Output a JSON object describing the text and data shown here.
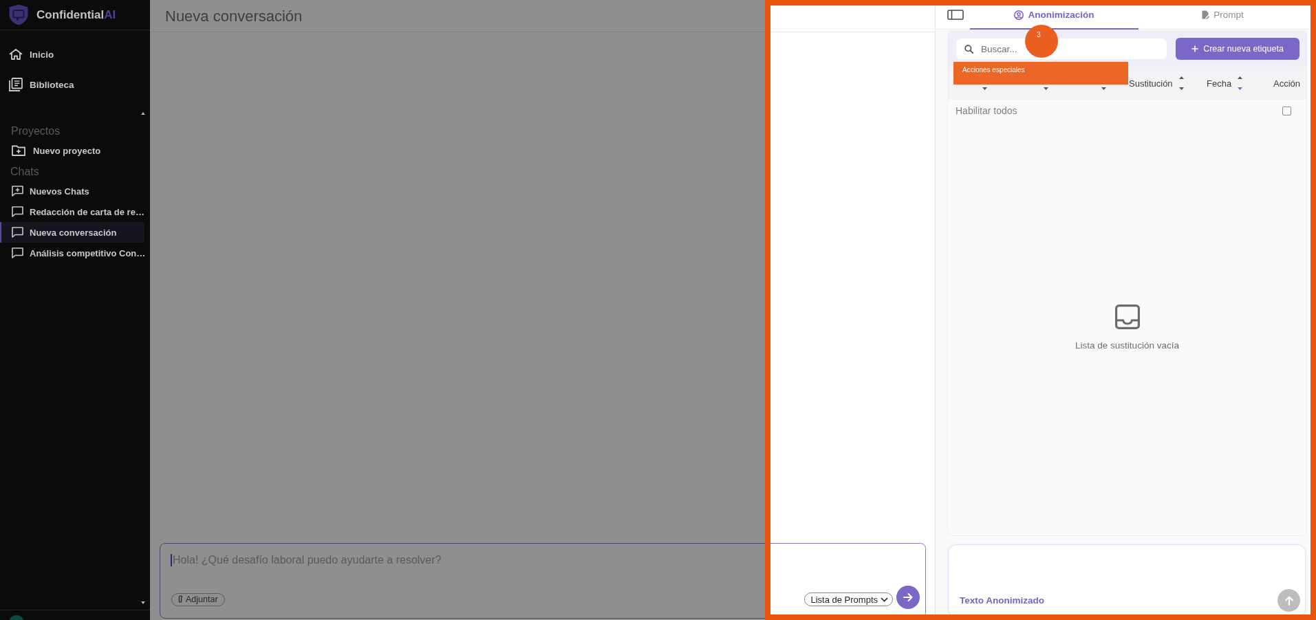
{
  "sidebar": {
    "brand": {
      "name": "Confidential",
      "accent": "AI"
    },
    "nav": [
      {
        "label": "Inicio"
      },
      {
        "label": "Biblioteca"
      }
    ],
    "sections": [
      {
        "title": "Proyectos",
        "items": [
          {
            "label": "Nuevo proyecto",
            "kind": "create",
            "selected": false
          }
        ]
      },
      {
        "title": "Chats",
        "items": [
          {
            "label": "Nuevos Chats",
            "kind": "create",
            "selected": false
          },
          {
            "label": "Redacción de carta de re…",
            "kind": "chat",
            "selected": false
          },
          {
            "label": "Nueva conversación",
            "kind": "chat",
            "selected": true
          },
          {
            "label": "Análisis competitivo Con…",
            "kind": "chat",
            "selected": false
          }
        ]
      }
    ]
  },
  "main": {
    "title": "Nueva conversación",
    "composer": {
      "placeholder": "Hola! ¿Qué desafío laboral puedo ayudarte a resolver?",
      "focused": true,
      "attach_button": "Adjuntar",
      "prompt_menu": "Lista de Prompts"
    }
  },
  "right_panel": {
    "tabs": [
      {
        "label": "Anonimización",
        "selected": true
      },
      {
        "label": "Prompt",
        "selected": false
      }
    ],
    "search": {
      "placeholder": "Buscar..."
    },
    "create_button": "Crear nueva etiqueta",
    "table": {
      "columns": [
        {
          "sorted": false
        },
        {
          "sorted": false
        },
        {
          "sorted": false
        },
        {
          "label": "Sustitución",
          "sorted": false
        },
        {
          "label": "Fecha",
          "sorted": true
        },
        {
          "label": "Acción"
        }
      ],
      "enable_all": {
        "label": "Habilitar todos",
        "checked": false
      },
      "empty_message": "Lista de sustitución vacía"
    },
    "output": {
      "label": "Texto Anonimizado"
    }
  },
  "tour": {
    "step": "3",
    "tooltip": "Acciones especiales"
  }
}
